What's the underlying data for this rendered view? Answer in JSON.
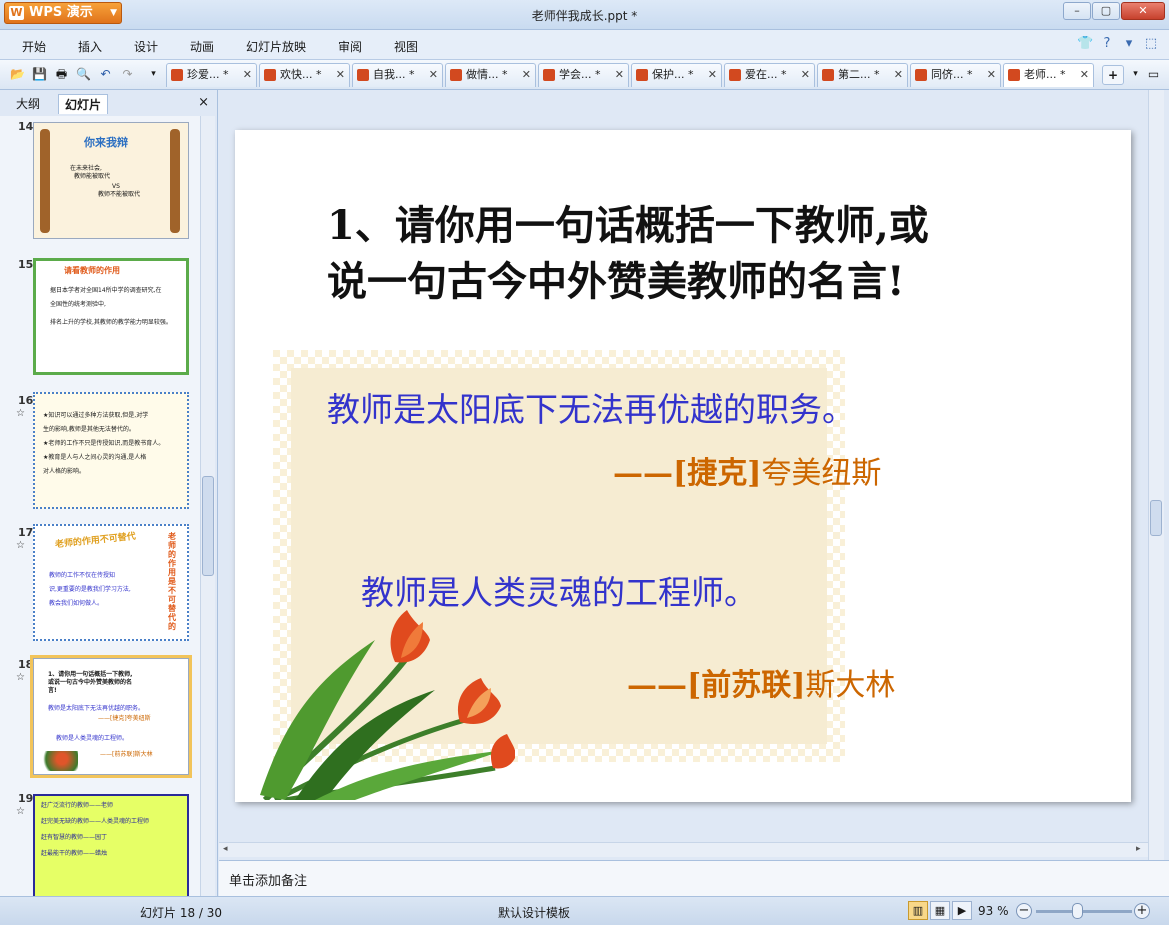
{
  "app": {
    "brand": "WPS 演示",
    "window_title": "老师伴我成长.ppt *"
  },
  "menu": [
    "开始",
    "插入",
    "设计",
    "动画",
    "幻灯片放映",
    "审阅",
    "视图"
  ],
  "doc_tabs": [
    {
      "label": "珍爱...",
      "mod": "*"
    },
    {
      "label": "欢快...",
      "mod": "*"
    },
    {
      "label": "自我...",
      "mod": "*"
    },
    {
      "label": "做情...",
      "mod": "*"
    },
    {
      "label": "学会...",
      "mod": "*"
    },
    {
      "label": "保护...",
      "mod": "*"
    },
    {
      "label": "爱在...",
      "mod": "*"
    },
    {
      "label": "第二...",
      "mod": "*"
    },
    {
      "label": "同侪...",
      "mod": "*"
    },
    {
      "label": "老师...",
      "mod": "*"
    }
  ],
  "left_pane": {
    "tab_outline": "大纲",
    "tab_slides": "幻灯片",
    "close": "×",
    "slides": [
      {
        "num": "14",
        "title": "你来我辩",
        "lines": [
          "在未来社会,",
          "教师能被取代",
          "VS",
          "教师不能被取代"
        ]
      },
      {
        "num": "15",
        "title": "请看教师的作用",
        "lines": [
          "据日本学者对全国14所中学的调查研究,在",
          "全国性的统考测验中,",
          "排名上升的学校,其教师的教学能力明显较强。"
        ]
      },
      {
        "num": "16",
        "lines": [
          "★知识可以通过多种方法获取,但是,对学",
          "生的影响,教师是其他无法替代的。",
          "★老师的工作不只是传授知识,而是教书育人。",
          "★教育是人与人之间心灵的沟通,是人格",
          "对人格的影响。"
        ]
      },
      {
        "num": "17",
        "title": "老师的作用不可替代",
        "side": "老师的作用是不可替代的",
        "lines": [
          "教师的工作不仅在传授知",
          "识,更重要的是教我们学习方法,",
          "教会我们如何做人。"
        ]
      },
      {
        "num": "18",
        "lines": [
          "1、请你用一句话概括一下教师,",
          "或说一句古今中外赞美教师的名",
          "言!",
          "教师是太阳底下无法再优越的职务。",
          "——[捷克]夸美纽斯",
          "教师是人类灵魂的工程师。",
          "——[前苏联]斯大林"
        ]
      },
      {
        "num": "19",
        "lines": [
          "赶广泛流行的教师——老师",
          "赶完美无缺的教师——人类灵魂的工程师",
          "赶有智慧的教师——园丁",
          "赶最能干的教师——蜡烛"
        ]
      }
    ]
  },
  "slide": {
    "title": "1、请你用一句话概括一下教师,或说一句古今中外赞美教师的名言!",
    "quote1": "教师是太阳底下无法再优越的职务。",
    "author1_dash": "——",
    "author1_country": "[捷克]",
    "author1_name": "夸美纽斯",
    "quote2": "教师是人类灵魂的工程师。",
    "author2_dash": "——",
    "author2_country": "[前苏联]",
    "author2_name": "斯大林"
  },
  "notes_placeholder": "单击添加备注",
  "status": {
    "slide_count": "幻灯片 18 / 30",
    "template": "默认设计模板",
    "zoom": "93 %"
  },
  "colors": {
    "quote_blue": "#3333cc",
    "author_orange": "#cc6600",
    "brand_orange": "#e0731b"
  }
}
